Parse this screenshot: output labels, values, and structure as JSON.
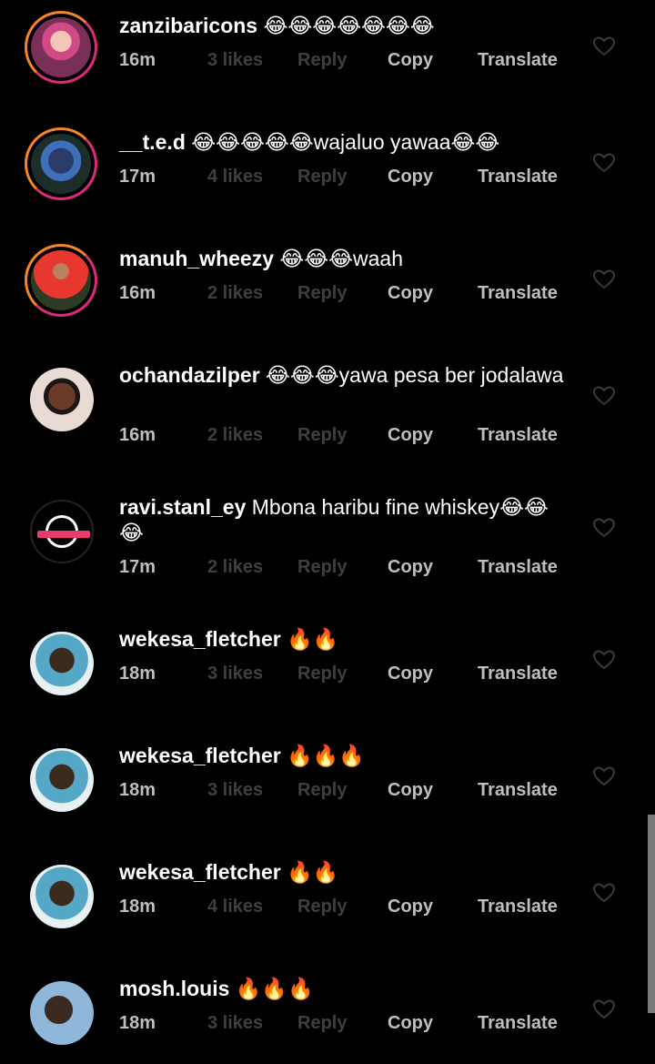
{
  "comments": [
    {
      "username": "zanzibaricons",
      "text": "😂😂😂😂😂😂😂",
      "time": "16m",
      "likes": "3 likes",
      "reply": "Reply",
      "copy": "Copy",
      "translate": "Translate"
    },
    {
      "username": "__t.e.d",
      "text": "😂😂😂😂😂wajaluo yawaa😂😂",
      "time": "17m",
      "likes": "4 likes",
      "reply": "Reply",
      "copy": "Copy",
      "translate": "Translate"
    },
    {
      "username": "manuh_wheezy",
      "text": "😂😂😂waah",
      "time": "16m",
      "likes": "2 likes",
      "reply": "Reply",
      "copy": "Copy",
      "translate": "Translate"
    },
    {
      "username": "ochandazilper",
      "text": "😂😂😂yawa pesa ber jodalawa",
      "time": "16m",
      "likes": "2 likes",
      "reply": "Reply",
      "copy": "Copy",
      "translate": "Translate"
    },
    {
      "username": "ravi.stanl_ey",
      "text": "Mbona haribu fine whiskey😂😂😂",
      "time": "17m",
      "likes": "2 likes",
      "reply": "Reply",
      "copy": "Copy",
      "translate": "Translate"
    },
    {
      "username": "wekesa_fletcher",
      "text": "🔥🔥",
      "time": "18m",
      "likes": "3 likes",
      "reply": "Reply",
      "copy": "Copy",
      "translate": "Translate"
    },
    {
      "username": "wekesa_fletcher",
      "text": "🔥🔥🔥",
      "time": "18m",
      "likes": "3 likes",
      "reply": "Reply",
      "copy": "Copy",
      "translate": "Translate"
    },
    {
      "username": "wekesa_fletcher",
      "text": "🔥🔥",
      "time": "18m",
      "likes": "4 likes",
      "reply": "Reply",
      "copy": "Copy",
      "translate": "Translate"
    },
    {
      "username": "mosh.louis",
      "text": "🔥🔥🔥",
      "time": "18m",
      "likes": "3 likes",
      "reply": "Reply",
      "copy": "Copy",
      "translate": "Translate"
    }
  ],
  "colors": {
    "background": "#000000",
    "story_ring_start": "#f58529",
    "story_ring_end": "#dd2a7b",
    "muted": "#3f3f3f",
    "secondary": "#bfbfbf"
  },
  "icons": {
    "like": "heart-icon"
  }
}
